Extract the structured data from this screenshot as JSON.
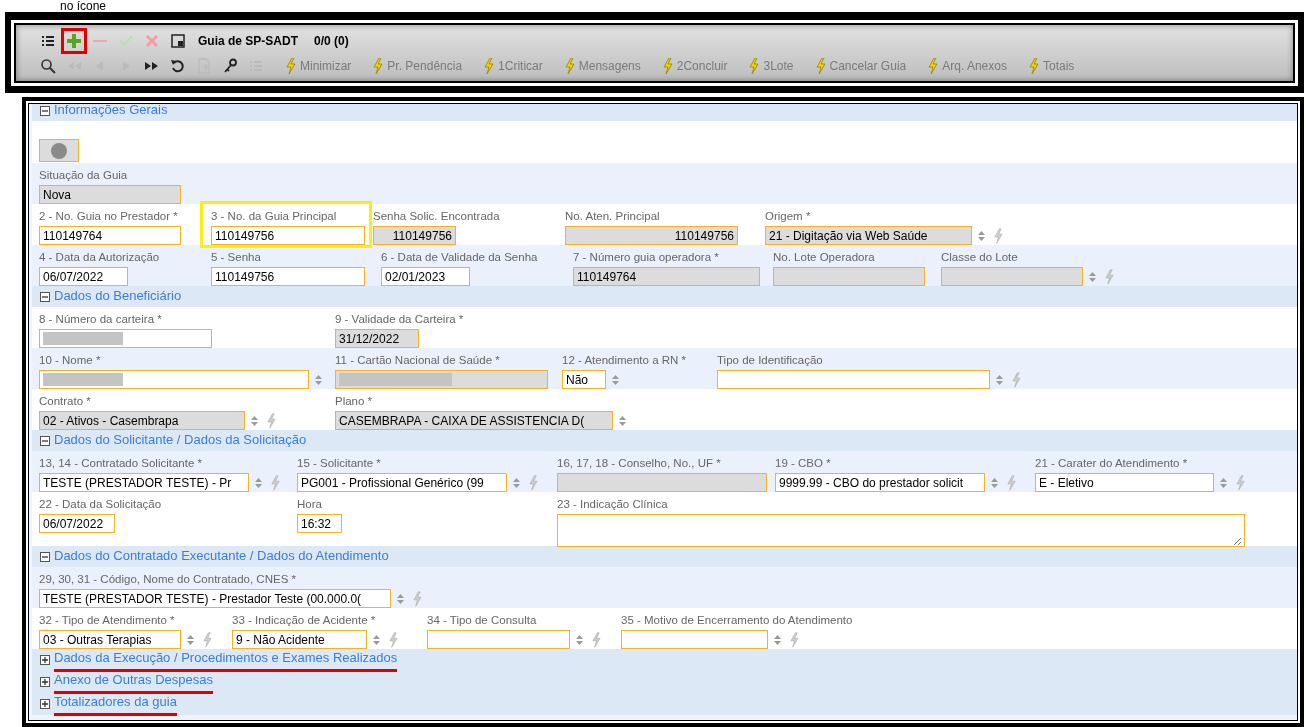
{
  "caption": "no ícone",
  "toolbar": {
    "tools": [
      {
        "kind": "list",
        "disabled": false
      },
      {
        "kind": "add",
        "disabled": false,
        "marked": true
      },
      {
        "kind": "remove",
        "disabled": true
      },
      {
        "kind": "confirm",
        "disabled": true
      },
      {
        "kind": "cancel",
        "disabled": true
      },
      {
        "kind": "window",
        "disabled": false
      }
    ],
    "title": "Guia de SP-SADT",
    "counter": "0/0 (0)",
    "nav": [
      {
        "kind": "search",
        "disabled": false
      },
      {
        "kind": "first",
        "disabled": true
      },
      {
        "kind": "previous",
        "disabled": true
      },
      {
        "kind": "next",
        "disabled": true
      },
      {
        "kind": "last",
        "disabled": false
      },
      {
        "kind": "undo",
        "disabled": false
      },
      {
        "kind": "document",
        "disabled": true
      },
      {
        "kind": "key",
        "disabled": false
      },
      {
        "kind": "list",
        "disabled": true
      }
    ],
    "actions": [
      {
        "label": "Minimizar"
      },
      {
        "label": "Pr. Pendência"
      },
      {
        "label": "1Criticar"
      },
      {
        "label": "Mensagens"
      },
      {
        "label": "2Concluir"
      },
      {
        "label": "3Lote"
      },
      {
        "label": "Cancelar Guia"
      },
      {
        "label": "Arq. Anexos"
      },
      {
        "label": "Totais"
      }
    ]
  },
  "sections": [
    {
      "title": "Informações Gerais",
      "expanded": true,
      "annotated": false,
      "rows": [
        {
          "kind": "status"
        },
        {
          "kind": "fields",
          "fields": [
            {
              "label": "Situação da Guia",
              "value": "Nova",
              "readonly": true
            }
          ]
        },
        {
          "kind": "fields",
          "fields": [
            {
              "label": "2 - No. Guia no Prestador *",
              "value": "110149764",
              "readonly": false
            },
            {
              "label": "3 - No. da Guia Principal",
              "value": "110149756",
              "readonly": false,
              "highlighted": true
            },
            {
              "label": "Senha Solic. Encontrada",
              "value": "110149756",
              "readonly": true,
              "align_right": true
            },
            {
              "label": "No. Aten. Principal",
              "value": "110149756",
              "readonly": true,
              "align_right": true
            },
            {
              "label": "Origem *",
              "value": "21 - Digitação via Web Saúde",
              "readonly": true,
              "spinner": true,
              "action": true
            }
          ]
        },
        {
          "kind": "fields",
          "fields": [
            {
              "label": "4 - Data da Autorização",
              "value": "06/07/2022",
              "readonly": false
            },
            {
              "label": "5 - Senha",
              "value": "110149756",
              "readonly": false
            },
            {
              "label": "6 - Data de Validade da Senha",
              "value": "02/01/2023",
              "readonly": false
            },
            {
              "label": "7 - Número guia operadora *",
              "value": "110149764",
              "readonly": true
            },
            {
              "label": "No. Lote Operadora",
              "readonly": true
            },
            {
              "label": "Classe do Lote",
              "readonly": true,
              "spinner": true,
              "action": true
            }
          ]
        }
      ]
    },
    {
      "title": "Dados do Beneficiário",
      "expanded": true,
      "annotated": false,
      "rows": [
        {
          "kind": "fields",
          "fields": [
            {
              "label": "8 - Número da carteira *",
              "readonly": false,
              "redacted": true
            },
            {
              "label": "9 - Validade da Carteira *",
              "value": "31/12/2022",
              "readonly": true
            }
          ]
        },
        {
          "kind": "fields",
          "fields": [
            {
              "label": "10 - Nome *",
              "readonly": false,
              "redacted": true,
              "spinner": true
            },
            {
              "label": "11 - Cartão Nacional de Saúde *",
              "readonly": true,
              "redacted": true
            },
            {
              "label": "12 - Atendimento a RN *",
              "value": "Não",
              "readonly": false,
              "spinner": true
            },
            {
              "label": "Tipo de Identificação",
              "readonly": false,
              "spinner": true,
              "action": true
            }
          ]
        },
        {
          "kind": "fields",
          "fields": [
            {
              "label": "Contrato *",
              "value": "02 - Ativos - Casembrapa",
              "readonly": true,
              "spinner": true,
              "action": true
            },
            {
              "label": "Plano *",
              "value": "CASEMBRAPA - CAIXA DE ASSISTENCIA D(",
              "readonly": true,
              "spinner": true
            }
          ]
        }
      ]
    },
    {
      "title": "Dados do Solicitante / Dados da Solicitação",
      "expanded": true,
      "annotated": false,
      "rows": [
        {
          "kind": "fields",
          "fields": [
            {
              "label": "13, 14 - Contratado Solicitante *",
              "value": "TESTE (PRESTADOR TESTE) - Pr",
              "readonly": false,
              "spinner": true,
              "action": true
            },
            {
              "label": "15 - Solicitante *",
              "value": "PG001 - Profissional Genérico (99",
              "readonly": false,
              "spinner": true,
              "action": true
            },
            {
              "label": "16, 17, 18 - Conselho, No., UF *",
              "readonly": true
            },
            {
              "label": "19 - CBO *",
              "value": "9999.99 - CBO do prestador solicit",
              "readonly": false,
              "spinner": true,
              "action": true
            },
            {
              "label": "21 - Carater do Atendimento *",
              "value": "E - Eletivo",
              "readonly": false,
              "spinner": true,
              "action": true
            }
          ]
        },
        {
          "kind": "fields",
          "fields": [
            {
              "label": "22 - Data da Solicitação",
              "value": "06/07/2022",
              "readonly": false
            },
            {
              "label": "Hora",
              "value": "16:32",
              "readonly": false
            },
            {
              "label": "23 - Indicação Clínica",
              "readonly": false,
              "multiline": true
            }
          ]
        }
      ]
    },
    {
      "title": "Dados do Contratado Executante / Dados do Atendimento",
      "expanded": true,
      "annotated": false,
      "rows": [
        {
          "kind": "fields",
          "fields": [
            {
              "label": "29, 30, 31 - Código, Nome do Contratado, CNES *",
              "value": "TESTE (PRESTADOR TESTE) - Prestador Teste (00.000.0(",
              "readonly": false,
              "spinner": true,
              "action": true
            }
          ]
        },
        {
          "kind": "fields",
          "fields": [
            {
              "label": "32 - Tipo de Atendimento *",
              "value": "03 - Outras Terapias",
              "readonly": false,
              "spinner": true,
              "action": true
            },
            {
              "label": "33 - Indicação de Acidente *",
              "value": "9 - Não Acidente",
              "readonly": false,
              "spinner": true,
              "action": true
            },
            {
              "label": "34 - Tipo de Consulta",
              "readonly": false,
              "spinner": true,
              "action": true
            },
            {
              "label": "35 - Motivo de Encerramento do Atendimento",
              "readonly": false,
              "spinner": true,
              "action": true
            }
          ]
        }
      ]
    },
    {
      "title": "Dados da Execução / Procedimentos e Exames Realizados",
      "expanded": false,
      "annotated": true
    },
    {
      "title": "Anexo de Outras Despesas",
      "expanded": false,
      "annotated": true
    },
    {
      "title": "Totalizadores da guia",
      "expanded": false,
      "annotated": true
    }
  ]
}
